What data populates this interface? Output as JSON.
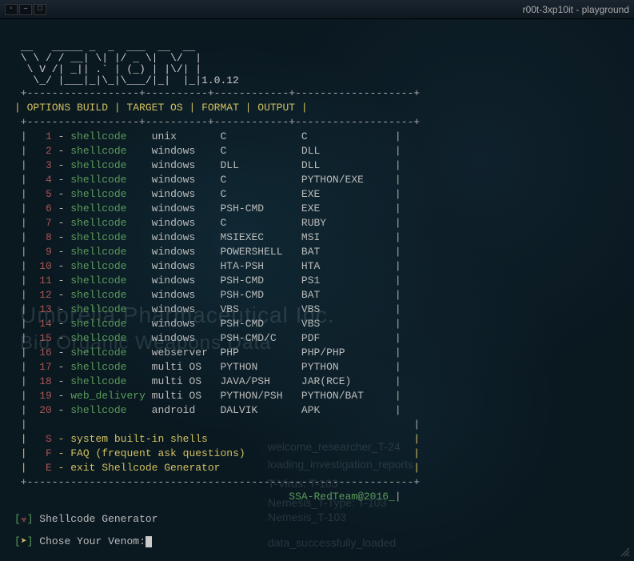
{
  "window": {
    "title": "r00t-3xp10it - playground"
  },
  "bg": {
    "company_line1": "Umbrella Pharmaceutical Inc.",
    "company_line2": "Bio Organic Weapons Data",
    "r1": "welcome_researcher_T-24",
    "r2": "loading_investigation_reports",
    "r3": "T-Virus: T-103",
    "r4": "Nemesis_T-Type: T-103",
    "r5": "Nemesis_T-103",
    "r6": "data_successfully_loaded"
  },
  "version": "1.0.12",
  "headers": {
    "c1": "OPTIONS BUILD",
    "c2": "TARGET OS",
    "c3": "FORMAT",
    "c4": "OUTPUT"
  },
  "rows": [
    {
      "n": "1",
      "build": "shellcode",
      "os": "unix",
      "fmt": "C",
      "out": "C"
    },
    {
      "n": "2",
      "build": "shellcode",
      "os": "windows",
      "fmt": "C",
      "out": "DLL"
    },
    {
      "n": "3",
      "build": "shellcode",
      "os": "windows",
      "fmt": "DLL",
      "out": "DLL"
    },
    {
      "n": "4",
      "build": "shellcode",
      "os": "windows",
      "fmt": "C",
      "out": "PYTHON/EXE"
    },
    {
      "n": "5",
      "build": "shellcode",
      "os": "windows",
      "fmt": "C",
      "out": "EXE"
    },
    {
      "n": "6",
      "build": "shellcode",
      "os": "windows",
      "fmt": "PSH-CMD",
      "out": "EXE"
    },
    {
      "n": "7",
      "build": "shellcode",
      "os": "windows",
      "fmt": "C",
      "out": "RUBY"
    },
    {
      "n": "8",
      "build": "shellcode",
      "os": "windows",
      "fmt": "MSIEXEC",
      "out": "MSI"
    },
    {
      "n": "9",
      "build": "shellcode",
      "os": "windows",
      "fmt": "POWERSHELL",
      "out": "BAT"
    },
    {
      "n": "10",
      "build": "shellcode",
      "os": "windows",
      "fmt": "HTA-PSH",
      "out": "HTA"
    },
    {
      "n": "11",
      "build": "shellcode",
      "os": "windows",
      "fmt": "PSH-CMD",
      "out": "PS1"
    },
    {
      "n": "12",
      "build": "shellcode",
      "os": "windows",
      "fmt": "PSH-CMD",
      "out": "BAT"
    },
    {
      "n": "13",
      "build": "shellcode",
      "os": "windows",
      "fmt": "VBS",
      "out": "VBS"
    },
    {
      "n": "14",
      "build": "shellcode",
      "os": "windows",
      "fmt": "PSH-CMD",
      "out": "VBS"
    },
    {
      "n": "15",
      "build": "shellcode",
      "os": "windows",
      "fmt": "PSH-CMD/C",
      "out": "PDF"
    },
    {
      "n": "16",
      "build": "shellcode",
      "os": "webserver",
      "fmt": "PHP",
      "out": "PHP/PHP"
    },
    {
      "n": "17",
      "build": "shellcode",
      "os": "multi OS",
      "fmt": "PYTHON",
      "out": "PYTHON"
    },
    {
      "n": "18",
      "build": "shellcode",
      "os": "multi OS",
      "fmt": "JAVA/PSH",
      "out": "JAR(RCE)"
    },
    {
      "n": "19",
      "build": "web_delivery",
      "os": "multi OS",
      "fmt": "PYTHON/PSH",
      "out": "PYTHON/BAT"
    },
    {
      "n": "20",
      "build": "shellcode",
      "os": "android",
      "fmt": "DALVIK",
      "out": "APK"
    }
  ],
  "menu": {
    "s": {
      "key": "S",
      "label": "system built-in shells"
    },
    "f": {
      "key": "F",
      "label": "FAQ (frequent ask questions)"
    },
    "e": {
      "key": "E",
      "label": "exit Shellcode Generator"
    }
  },
  "footer_team": "SSA-RedTeam@2016_",
  "prompt": {
    "line1": "Shellcode Generator",
    "line2": "Chose Your Venom:"
  }
}
